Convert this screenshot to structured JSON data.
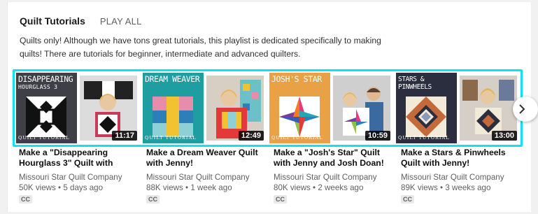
{
  "playlist": {
    "title": "Quilt Tutorials",
    "play_all": "PLAY ALL",
    "description": "Quilts only! Although we have tons great tutorials, this playlist is dedicated specifically to making quilts! There are tutorials for beginner, intermediate and advanced quilters."
  },
  "colors": {
    "selection_border": "#12e1ef",
    "meta_text": "#606060"
  },
  "icons": {
    "next": "chevron-right-icon"
  },
  "videos": [
    {
      "thumb_title": "Disappearing",
      "thumb_subtitle": "Hourglass 3",
      "thumb_footer": "QUILT TUTORIAL",
      "duration": "11:17",
      "title": "Make a \"Disappearing Hourglass 3\" Quilt with",
      "channel": "Missouri Star Quilt Company",
      "meta": "50K views • 5 days ago",
      "badge": "CC",
      "bg": "#3f3f47"
    },
    {
      "thumb_title": "Dream Weaver",
      "thumb_subtitle": "",
      "thumb_footer": "QUILT TUTORIAL",
      "duration": "12:49",
      "title": "Make a Dream Weaver Quilt with Jenny!",
      "channel": "Missouri Star Quilt Company",
      "meta": "88K views • 1 week ago",
      "badge": "CC",
      "bg": "#1f9ea1"
    },
    {
      "thumb_title": "Josh's Star",
      "thumb_subtitle": "",
      "thumb_footer": "QUILT TUTORIAL",
      "duration": "10:59",
      "title": "Make a \"Josh's Star\" Quilt with Jenny and Josh Doan!",
      "channel": "Missouri Star Quilt Company",
      "meta": "80K views • 2 weeks ago",
      "badge": "CC",
      "bg": "#e8a144"
    },
    {
      "thumb_title": "Stars & Pinwheels",
      "thumb_subtitle": "",
      "thumb_footer": "QUILT TUTORIAL",
      "duration": "13:00",
      "title": "Make a Stars & Pinwheels Quilt with Jenny!",
      "channel": "Missouri Star Quilt Company",
      "meta": "89K views • 3 weeks ago",
      "badge": "CC",
      "bg": "#2a2e3e"
    }
  ]
}
